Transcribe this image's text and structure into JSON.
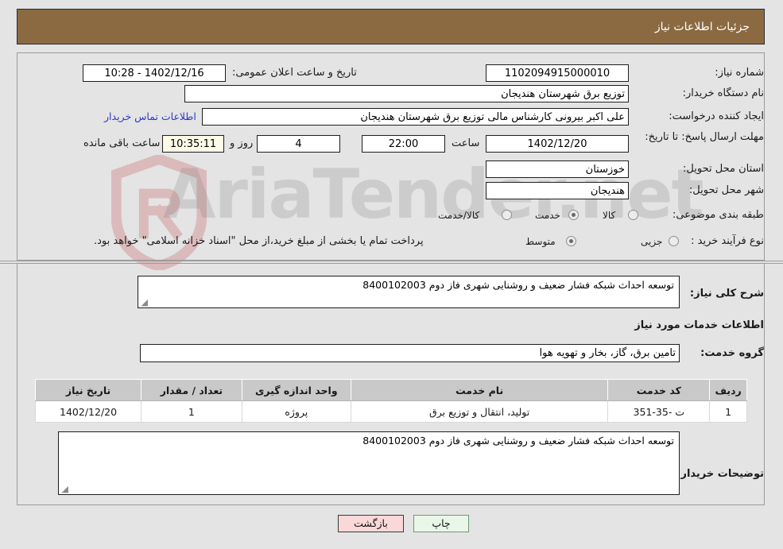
{
  "header": {
    "title": "جزئیات اطلاعات نیاز"
  },
  "top_form": {
    "need_number_label": "شماره نیاز:",
    "need_number_value": "1102094915000010",
    "announce_datetime_label": "تاریخ و ساعت اعلان عمومی:",
    "announce_datetime_value": "1402/12/16 - 10:28",
    "buyer_org_label": "نام دستگاه خریدار:",
    "buyer_org_value": "توزیع برق شهرستان هندیجان",
    "request_creator_label": "ایجاد کننده درخواست:",
    "request_creator_value": "علی اکبر بیرونی کارشناس مالی توزیع برق شهرستان هندیجان",
    "buyer_contact_link": "اطلاعات تماس خریدار",
    "deadline_label": "مهلت ارسال پاسخ: تا تاریخ:",
    "deadline_date": "1402/12/20",
    "deadline_hour_label": "ساعت",
    "deadline_hour_value": "22:00",
    "remaining_days_value": "4",
    "remaining_days_label": "روز و",
    "remaining_timer_value": "10:35:11",
    "remaining_hours_label": "ساعت باقی مانده",
    "delivery_province_label": "استان محل تحویل:",
    "delivery_province_value": "خوزستان",
    "delivery_city_label": "شهر محل تحویل:",
    "delivery_city_value": "هندیجان",
    "category_label": "طبقه بندی موضوعی:",
    "category_options": [
      {
        "label": "کالا",
        "selected": false
      },
      {
        "label": "خدمت",
        "selected": true
      },
      {
        "label": "کالا/خدمت",
        "selected": false
      }
    ],
    "process_label": "نوع فرآیند خرید :",
    "process_options": [
      {
        "label": "جزیی",
        "selected": false
      },
      {
        "label": "متوسط",
        "selected": true
      }
    ],
    "payment_note": "پرداخت تمام یا بخشی از مبلغ خرید،از محل \"اسناد خزانه اسلامی\" خواهد بود."
  },
  "middle": {
    "general_desc_label": "شرح کلی نیاز:",
    "general_desc_value": "توسعه  احداث شبکه فشار ضعیف و روشنایی شهری فاز دوم 8400102003",
    "services_info_heading": "اطلاعات خدمات مورد نیاز",
    "service_group_label": "گروه خدمت:",
    "service_group_value": "تامین برق، گاز، بخار و تهویه هوا"
  },
  "table": {
    "headers": [
      "ردیف",
      "کد خدمت",
      "نام خدمت",
      "واحد اندازه گیری",
      "تعداد / مقدار",
      "تاریخ نیاز"
    ],
    "rows": [
      {
        "row_no": "1",
        "service_code": "ت -35-351",
        "service_name": "تولید، انتقال و توزیع برق",
        "unit": "پروژه",
        "quantity": "1",
        "need_date": "1402/12/20"
      }
    ]
  },
  "buyer_notes": {
    "label": "توضیحات خریدار:",
    "value": "توسعه  احداث شبکه فشار ضعیف و روشنایی شهری فاز دوم 8400102003"
  },
  "buttons": {
    "print": "چاپ",
    "back": "بازگشت"
  },
  "watermark": {
    "text": "AriaTender.net"
  },
  "colors": {
    "header_bg": "#8b6a42",
    "page_bg": "#e4e4e4",
    "link": "#2b37c8",
    "timer_bg": "#fbfbe8",
    "print_btn_bg": "#e9f7e9",
    "back_btn_bg": "#fbd8d8",
    "table_header_bg": "#c9c9c9"
  }
}
